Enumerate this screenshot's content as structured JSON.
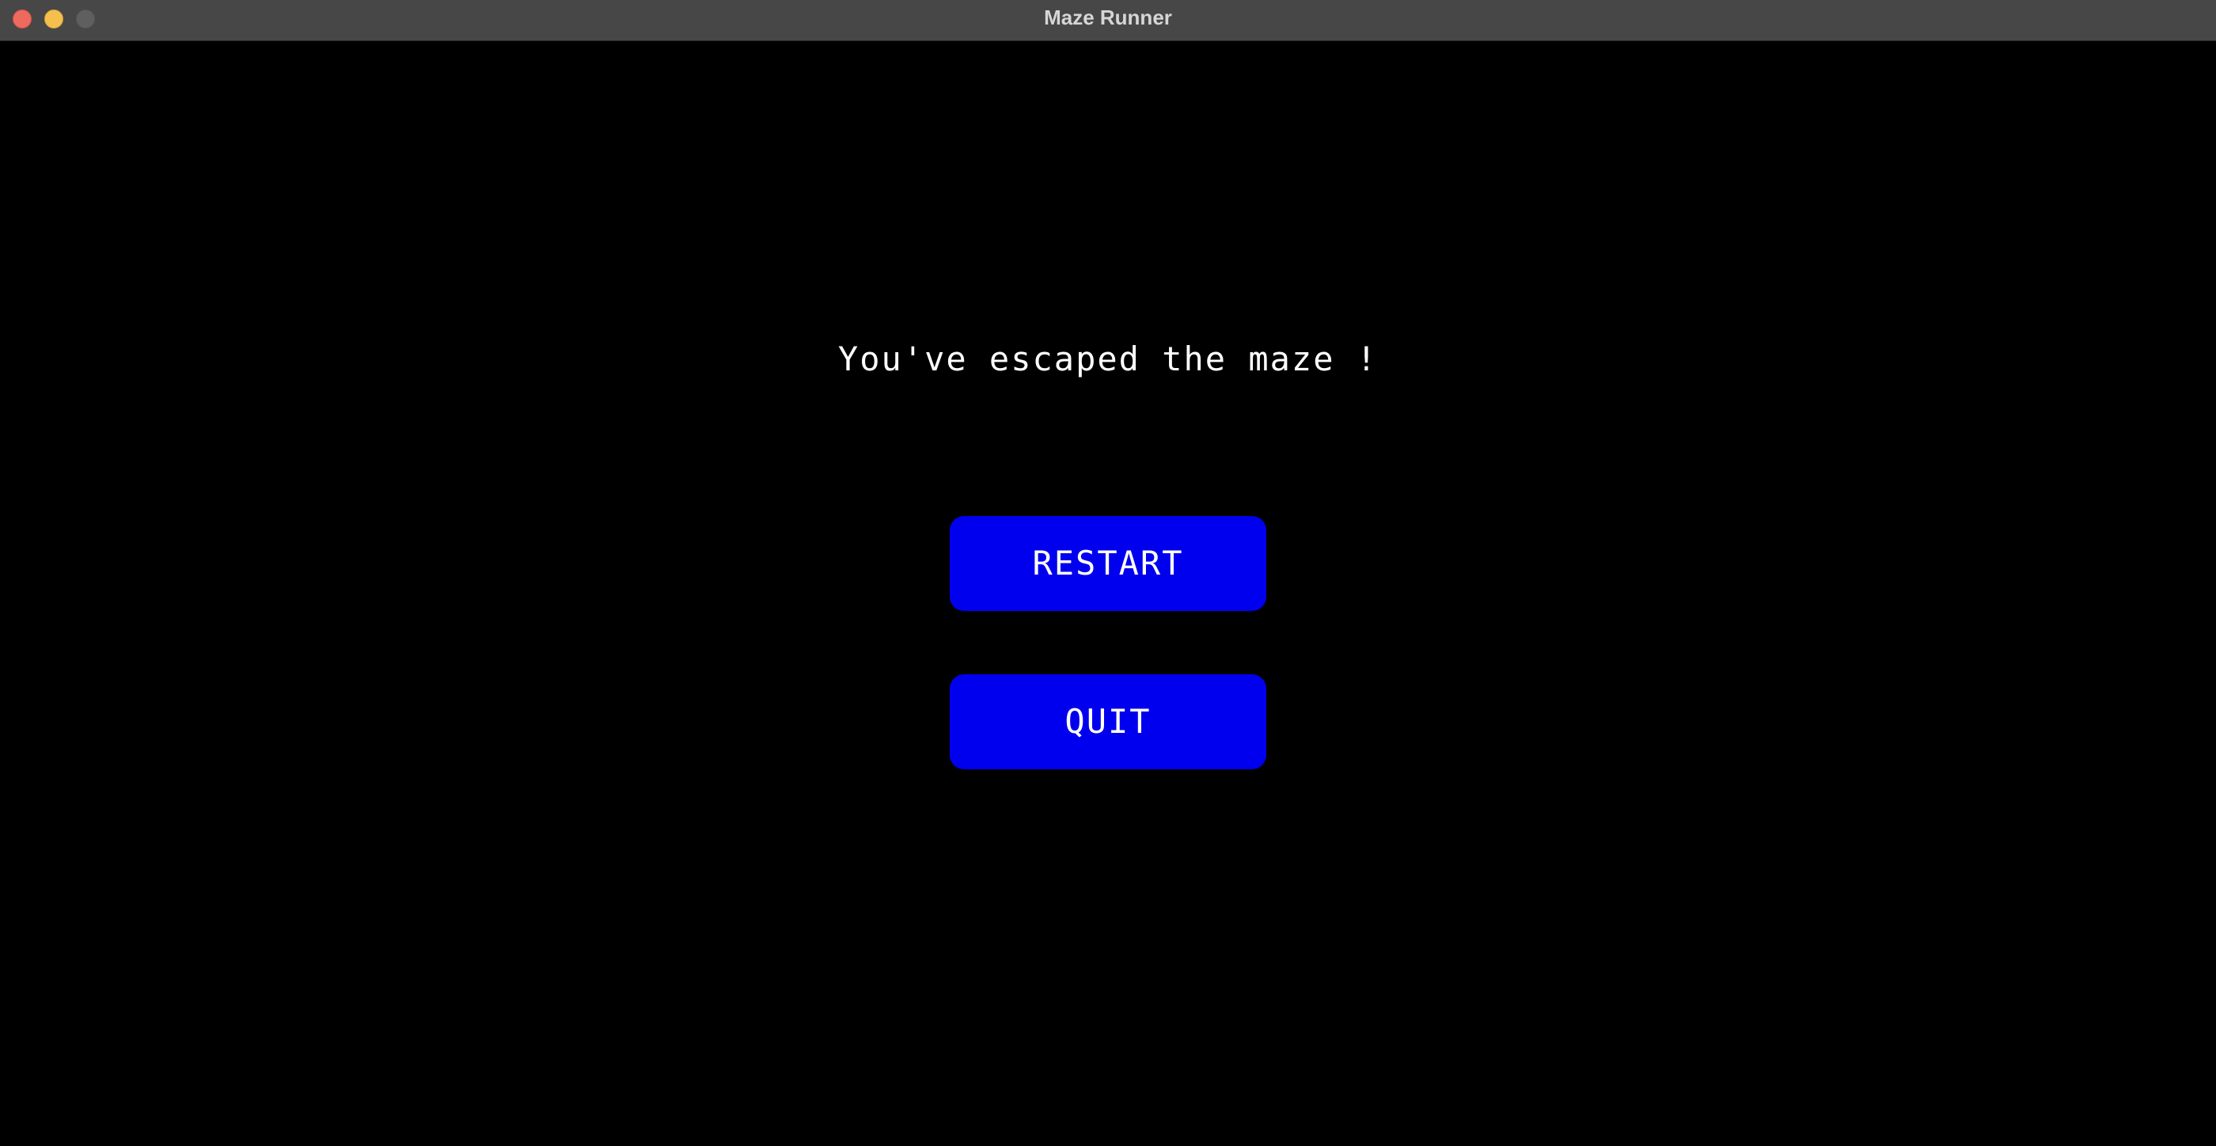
{
  "window": {
    "title": "Maze Runner"
  },
  "game": {
    "message": "You've escaped the maze !",
    "buttons": {
      "restart_label": "RESTART",
      "quit_label": "QUIT"
    }
  },
  "colors": {
    "background": "#000000",
    "button": "#0000ee",
    "text": "#ffffff",
    "titlebar": "#474747"
  }
}
